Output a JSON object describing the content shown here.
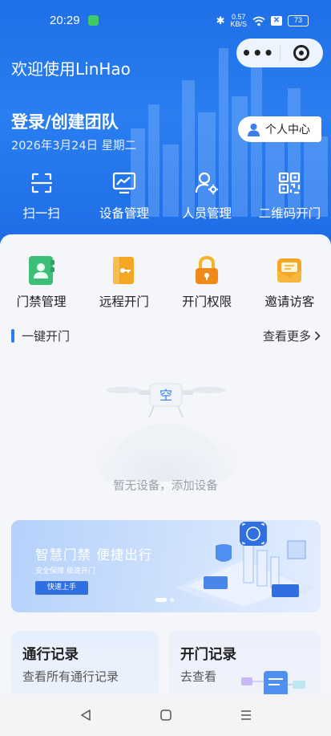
{
  "status": {
    "time": "20:29",
    "network_speed": "0.57",
    "network_unit": "KB/S",
    "battery": "73"
  },
  "header": {
    "welcome": "欢迎使用LinHao",
    "team": "登录/创建团队",
    "date": "2026年3月24日 星期二",
    "personal_center": "个人中心"
  },
  "top_actions": [
    {
      "label": "扫一扫",
      "icon": "scan-icon"
    },
    {
      "label": "设备管理",
      "icon": "device-monitor-icon"
    },
    {
      "label": "人员管理",
      "icon": "user-gear-icon"
    },
    {
      "label": "二维码开门",
      "icon": "qrcode-icon"
    }
  ],
  "quick_actions": [
    {
      "label": "门禁管理",
      "icon": "access-book-icon",
      "color": "#3dbf7a"
    },
    {
      "label": "远程开门",
      "icon": "remote-door-icon",
      "color": "#f5a623"
    },
    {
      "label": "开门权限",
      "icon": "lock-icon",
      "color": "#f0a01a"
    },
    {
      "label": "邀请访客",
      "icon": "envelope-icon",
      "color": "#f5a623"
    }
  ],
  "section": {
    "title": "一键开门",
    "more": "查看更多"
  },
  "empty": {
    "text": "暂无设备，添加设备"
  },
  "banner": {
    "title": "智慧门禁  便捷出行",
    "subtitle": "安全保障  极速开门",
    "button": "快速上手"
  },
  "records": {
    "left": {
      "title": "通行记录",
      "subtitle": "查看所有通行记录"
    },
    "right": {
      "title": "开门记录",
      "subtitle": "去查看"
    }
  },
  "colors": {
    "primary": "#2a7ef0",
    "header_bg": "#1f6fe8"
  }
}
